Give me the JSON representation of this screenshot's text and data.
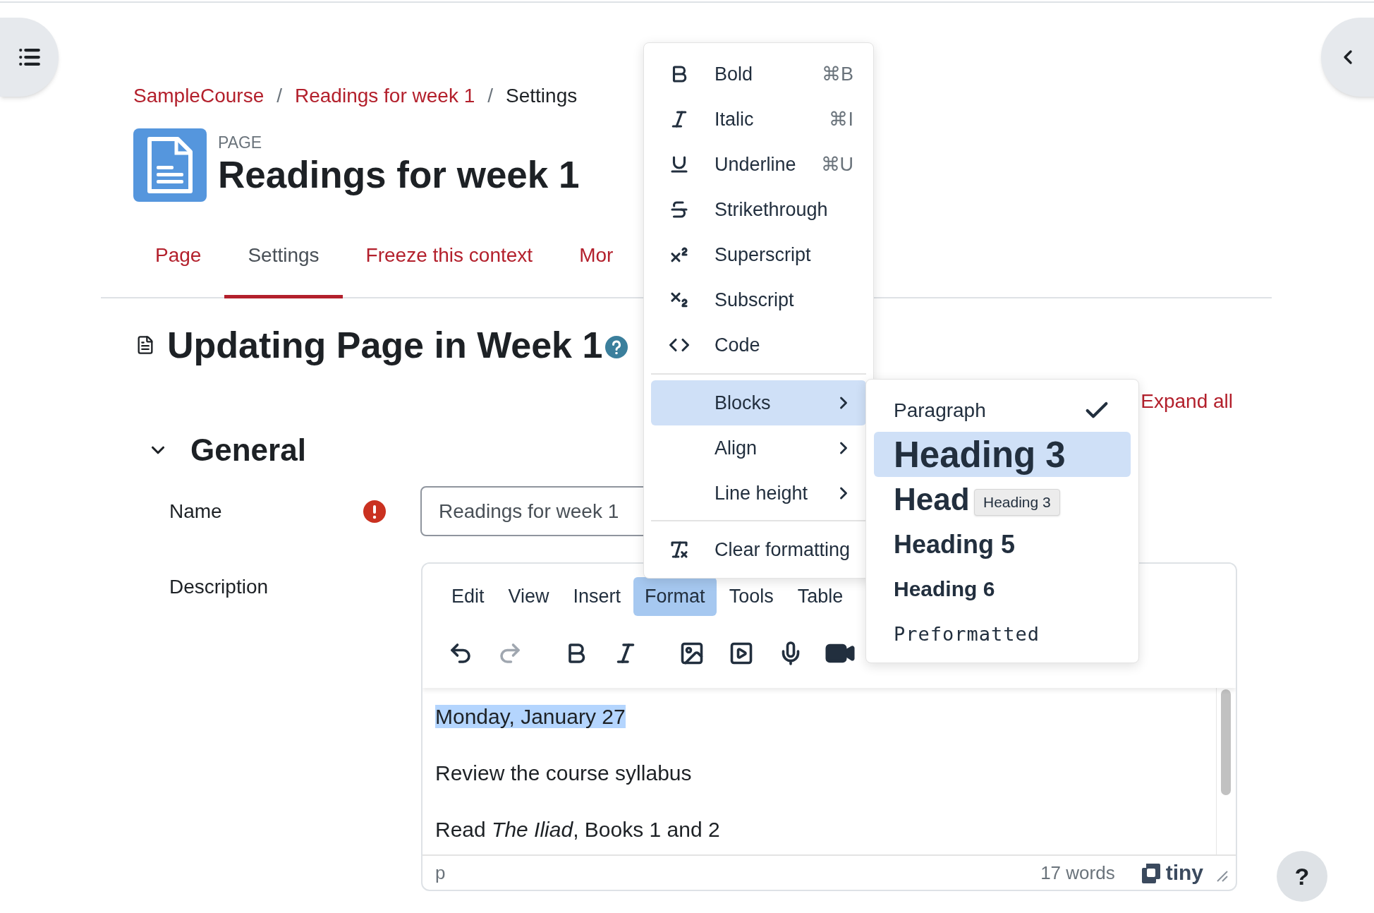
{
  "breadcrumb_separator": "/",
  "breadcrumb": [
    {
      "label": "SampleCourse",
      "kind": "link"
    },
    {
      "label": "Readings for week 1",
      "kind": "link"
    },
    {
      "label": "Settings",
      "kind": "current"
    }
  ],
  "activity": {
    "type_label": "PAGE",
    "title": "Readings for week 1"
  },
  "tabs": [
    {
      "label": "Page",
      "selected": false
    },
    {
      "label": "Settings",
      "selected": true
    },
    {
      "label": "Freeze this context",
      "selected": false
    },
    {
      "label": "Mor",
      "selected": false
    }
  ],
  "heading": "Updating Page in Week 1",
  "expand_all": "Expand all",
  "section": {
    "title": "General",
    "expanded": true
  },
  "name_field": {
    "label": "Name",
    "required": true,
    "value": "Readings for week 1"
  },
  "description_field": {
    "label": "Description"
  },
  "editor": {
    "menubar": [
      {
        "label": "Edit",
        "selected": false
      },
      {
        "label": "View",
        "selected": false
      },
      {
        "label": "Insert",
        "selected": false
      },
      {
        "label": "Format",
        "selected": true
      },
      {
        "label": "Tools",
        "selected": false
      },
      {
        "label": "Table",
        "selected": false
      }
    ],
    "toolbar": [
      {
        "kind": "undo",
        "disabled": false
      },
      {
        "kind": "redo",
        "disabled": true
      },
      {
        "kind": "bold",
        "disabled": false
      },
      {
        "kind": "italic",
        "disabled": false
      },
      {
        "kind": "image",
        "disabled": false
      },
      {
        "kind": "media",
        "disabled": false
      },
      {
        "kind": "audio",
        "disabled": false
      },
      {
        "kind": "video",
        "disabled": false
      }
    ],
    "content": [
      {
        "text": "Monday, January 27",
        "selected": true
      },
      {
        "text": "Review the course syllabus",
        "selected": false
      },
      {
        "text": "Read *The Iliad*, Books 1 and 2",
        "selected": false
      }
    ],
    "path": "p",
    "word_count": "17 words",
    "brand": "tiny"
  },
  "format_menu": {
    "groups": [
      [
        {
          "kind": "bold",
          "label": "Bold",
          "shortcut": "⌘B",
          "selected": false
        },
        {
          "kind": "italic",
          "label": "Italic",
          "shortcut": "⌘I",
          "selected": false
        },
        {
          "kind": "underline",
          "label": "Underline",
          "shortcut": "⌘U",
          "selected": false
        },
        {
          "kind": "strikethrough",
          "label": "Strikethrough",
          "selected": false
        },
        {
          "kind": "superscript",
          "label": "Superscript",
          "selected": false
        },
        {
          "kind": "subscript",
          "label": "Subscript",
          "selected": false
        },
        {
          "kind": "code",
          "label": "Code",
          "selected": false
        }
      ],
      [
        {
          "kind": "submenu",
          "label": "Blocks",
          "selected": true
        },
        {
          "kind": "submenu",
          "label": "Align",
          "selected": false
        },
        {
          "kind": "submenu",
          "label": "Line height",
          "selected": false
        }
      ],
      [
        {
          "kind": "clear",
          "label": "Clear formatting",
          "selected": false
        }
      ]
    ]
  },
  "blocks_menu": [
    {
      "kind": "paragraph",
      "label": "Paragraph",
      "checked": true,
      "selected": false
    },
    {
      "kind": "h3",
      "label": "Heading 3",
      "checked": false,
      "selected": true
    },
    {
      "kind": "h4",
      "label": "Head",
      "checked": false,
      "selected": false
    },
    {
      "kind": "h5",
      "label": "Heading 5",
      "checked": false,
      "selected": false
    },
    {
      "kind": "h6",
      "label": "Heading 6",
      "checked": false,
      "selected": false
    },
    {
      "kind": "pre",
      "label": "Preformatted",
      "checked": false,
      "selected": false
    }
  ],
  "tooltip": "Heading 3",
  "help_button": "?"
}
